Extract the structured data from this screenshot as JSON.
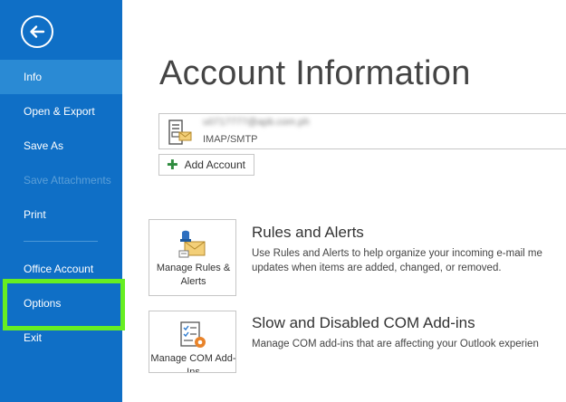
{
  "sidebar": {
    "back_icon": "back-arrow-icon",
    "items": [
      {
        "label": "Info"
      },
      {
        "label": "Open & Export"
      },
      {
        "label": "Save As"
      },
      {
        "label": "Save Attachments"
      },
      {
        "label": "Print"
      },
      {
        "label": "Office Account"
      },
      {
        "label": "Options"
      },
      {
        "label": "Exit"
      }
    ],
    "selected": "Info",
    "highlighted": "Options"
  },
  "main": {
    "title": "Account Information",
    "account": {
      "email": "u0717777@apb.com.ph",
      "type": "IMAP/SMTP",
      "add_label": "Add Account"
    },
    "sections": [
      {
        "button_label": "Manage Rules & Alerts",
        "title": "Rules and Alerts",
        "desc_line1": "Use Rules and Alerts to help organize your incoming e-mail me",
        "desc_line2": "updates when items are added, changed, or removed."
      },
      {
        "button_label": "Manage COM Add-Ins",
        "title": "Slow and Disabled COM Add-ins",
        "desc_line1": "Manage COM add-ins that are affecting your Outlook experien"
      }
    ]
  },
  "colors": {
    "sidebar": "#0f6fc6",
    "selected": "#2a8ad4",
    "highlight": "#66ee22",
    "disabled_text": "#5b9fd8"
  }
}
